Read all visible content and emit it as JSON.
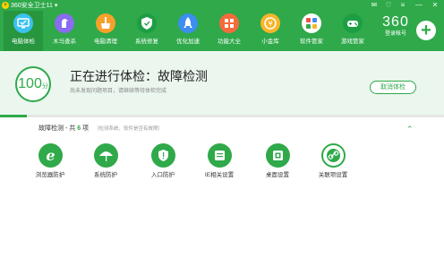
{
  "titlebar": {
    "logo_glyph": "+",
    "title": "360安全卫士11 ▾",
    "controls": [
      "✉",
      "♡",
      "≡",
      "—",
      "✕"
    ]
  },
  "nav": {
    "items": [
      {
        "label": "电脑体检",
        "icon": "monitor-check-icon",
        "active": true
      },
      {
        "label": "木马查杀",
        "icon": "horse-icon",
        "active": false
      },
      {
        "label": "电脑清理",
        "icon": "broom-icon",
        "active": false
      },
      {
        "label": "系统修复",
        "icon": "shield-icon",
        "active": false
      },
      {
        "label": "优化加速",
        "icon": "rocket-icon",
        "active": false
      },
      {
        "label": "功能大全",
        "icon": "grid-icon",
        "active": false
      },
      {
        "label": "小金库",
        "icon": "coin-icon",
        "active": false
      },
      {
        "label": "软件管家",
        "icon": "apps-icon",
        "active": false
      },
      {
        "label": "游戏管家",
        "icon": "gamepad-icon",
        "active": false
      }
    ]
  },
  "account": {
    "brand": "360",
    "login_label": "登录帐号",
    "plus": "+"
  },
  "banner": {
    "score": "100",
    "score_unit": "分",
    "status": "正在进行体检：故障检测",
    "subtext": "尚未发现问题项目，请继续等待体检完成",
    "cancel_label": "取消体检"
  },
  "progress": {
    "value": 0.06
  },
  "section": {
    "prefix": "故障检测 - 共",
    "count": "6",
    "suffix": "项",
    "note": "（检测系统、软件是否有故障）"
  },
  "checks": [
    {
      "label": "浏览器防护",
      "icon": "ie-icon",
      "outline": false
    },
    {
      "label": "系统防护",
      "icon": "umbrella-icon",
      "outline": false
    },
    {
      "label": "入口防护",
      "icon": "shield-icon",
      "outline": false
    },
    {
      "label": "IE相关设置",
      "icon": "ie-settings-icon",
      "outline": false
    },
    {
      "label": "桌面设置",
      "icon": "desktop-icon",
      "outline": false
    },
    {
      "label": "关联项设置",
      "icon": "link-icon",
      "outline": true
    }
  ],
  "colors": {
    "brand_green": "#2fa94a",
    "banner_bg": "#eaf6ee"
  }
}
